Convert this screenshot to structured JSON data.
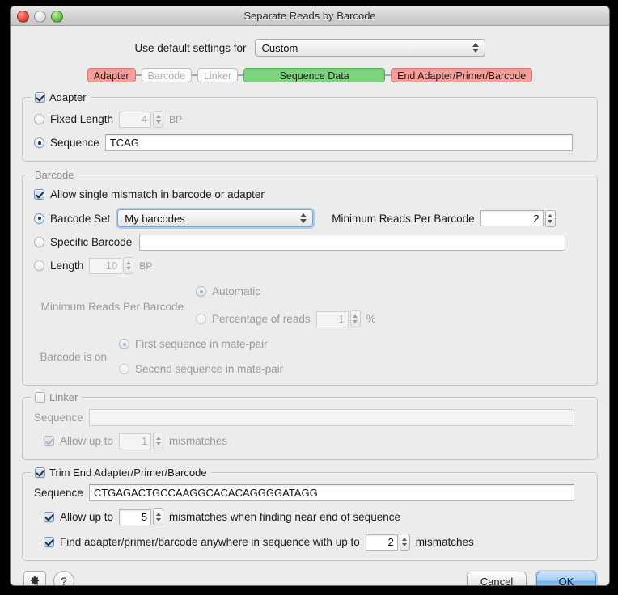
{
  "window": {
    "title": "Separate Reads by Barcode",
    "traffic_lights": [
      "close-button",
      "minimize-button",
      "zoom-button"
    ]
  },
  "defaults": {
    "label": "Use default settings for",
    "selected": "Custom"
  },
  "pipeline_chips": [
    {
      "label": "Adapter",
      "state": "active-pink"
    },
    {
      "label": "Barcode",
      "state": "disabled"
    },
    {
      "label": "Linker",
      "state": "disabled"
    },
    {
      "label": "Sequence Data",
      "state": "active-green"
    },
    {
      "label": "End Adapter/Primer/Barcode",
      "state": "active-pink"
    }
  ],
  "adapter": {
    "legend": "Adapter",
    "checked": true,
    "fixed_length": {
      "label": "Fixed Length",
      "selected": false,
      "value": "4",
      "unit": "BP"
    },
    "sequence": {
      "label": "Sequence",
      "selected": true,
      "value": "TCAG"
    }
  },
  "barcode": {
    "legend": "Barcode",
    "allow_mismatch": {
      "label": "Allow single mismatch in barcode or adapter",
      "checked": true
    },
    "barcode_set": {
      "label": "Barcode Set",
      "selected": true,
      "value": "My barcodes"
    },
    "min_reads_inline": {
      "label": "Minimum Reads Per Barcode",
      "value": "2"
    },
    "specific_barcode": {
      "label": "Specific Barcode",
      "selected": false,
      "value": ""
    },
    "length": {
      "label": "Length",
      "selected": false,
      "value": "10",
      "unit": "BP"
    },
    "min_reads_group": {
      "label": "Minimum Reads Per Barcode",
      "automatic": {
        "label": "Automatic",
        "selected": true
      },
      "percentage": {
        "label": "Percentage of reads",
        "selected": false,
        "value": "1",
        "unit": "%"
      }
    },
    "barcode_is_on": {
      "label": "Barcode is on",
      "options": [
        {
          "label": "First sequence in mate-pair",
          "selected": true
        },
        {
          "label": "Second sequence in mate-pair",
          "selected": false
        }
      ]
    }
  },
  "linker": {
    "legend": "Linker",
    "checked": false,
    "sequence": {
      "label": "Sequence",
      "value": ""
    },
    "allow_up_to": {
      "prefix": "Allow up to",
      "checked": true,
      "value": "1",
      "suffix": "mismatches"
    }
  },
  "trim_end": {
    "legend": "Trim End Adapter/Primer/Barcode",
    "checked": true,
    "sequence": {
      "label": "Sequence",
      "value": "CTGAGACTGCCAAGGCACACAGGGGATAGG"
    },
    "allow_up_to": {
      "prefix": "Allow up to",
      "checked": true,
      "value": "5",
      "suffix": "mismatches when finding near end of sequence"
    },
    "find_anywhere": {
      "prefix": "Find adapter/primer/barcode anywhere in sequence with up to",
      "checked": true,
      "value": "2",
      "suffix": "mismatches"
    }
  },
  "footer": {
    "gear_icon": "gear-icon",
    "help_icon": "help-icon",
    "cancel_label": "Cancel",
    "ok_label": "OK"
  },
  "colors": {
    "chip_pink": "#f79e9a",
    "chip_green": "#7ed47e",
    "default_button": "#71b2ef",
    "window_bg": "#ececec"
  }
}
